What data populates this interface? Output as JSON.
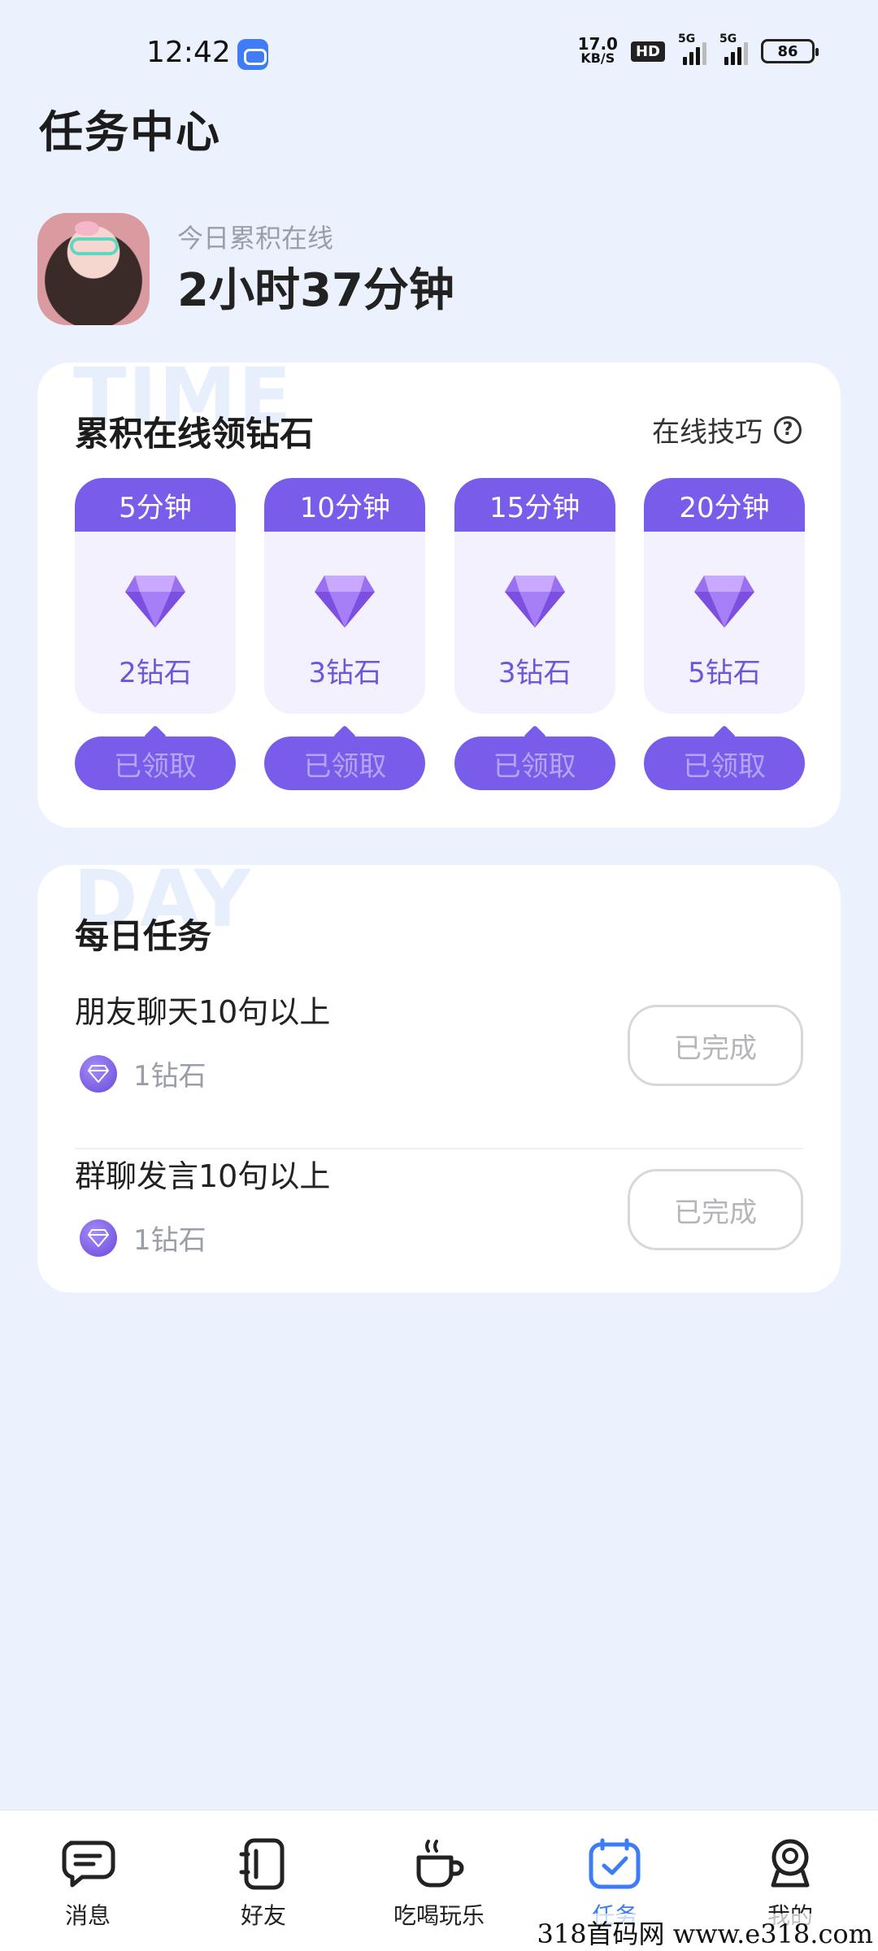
{
  "status_bar": {
    "time": "12:42",
    "net_speed_value": "17.0",
    "net_speed_unit": "KB/S",
    "hd": "HD",
    "signal_1": "5G",
    "signal_2": "5G",
    "battery": "86"
  },
  "header": {
    "title": "任务中心"
  },
  "profile": {
    "online_label": "今日累积在线",
    "online_value": "2小时37分钟"
  },
  "time_card": {
    "watermark": "TIME",
    "title": "累积在线领钻石",
    "tips_label": "在线技巧",
    "rewards": [
      {
        "duration": "5分钟",
        "amount": "2钻石",
        "button": "已领取"
      },
      {
        "duration": "10分钟",
        "amount": "3钻石",
        "button": "已领取"
      },
      {
        "duration": "15分钟",
        "amount": "3钻石",
        "button": "已领取"
      },
      {
        "duration": "20分钟",
        "amount": "5钻石",
        "button": "已领取"
      }
    ]
  },
  "daily_card": {
    "watermark": "DAY",
    "title": "每日任务",
    "tasks": [
      {
        "name": "朋友聊天10句以上",
        "reward": "1钻石",
        "status": "已完成"
      },
      {
        "name": "群聊发言10句以上",
        "reward": "1钻石",
        "status": "已完成"
      }
    ]
  },
  "bottom_nav": {
    "items": [
      {
        "label": "消息",
        "icon": "message-icon"
      },
      {
        "label": "好友",
        "icon": "friends-icon"
      },
      {
        "label": "吃喝玩乐",
        "icon": "cup-icon"
      },
      {
        "label": "任务",
        "icon": "task-icon"
      },
      {
        "label": "我的",
        "icon": "profile-icon"
      }
    ],
    "active": "任务"
  },
  "footer_watermark": "318首码网 www.e318.com",
  "colors": {
    "accent": "#7a5cea",
    "nav_active": "#3d7cf5",
    "background": "#ecf2fd"
  }
}
